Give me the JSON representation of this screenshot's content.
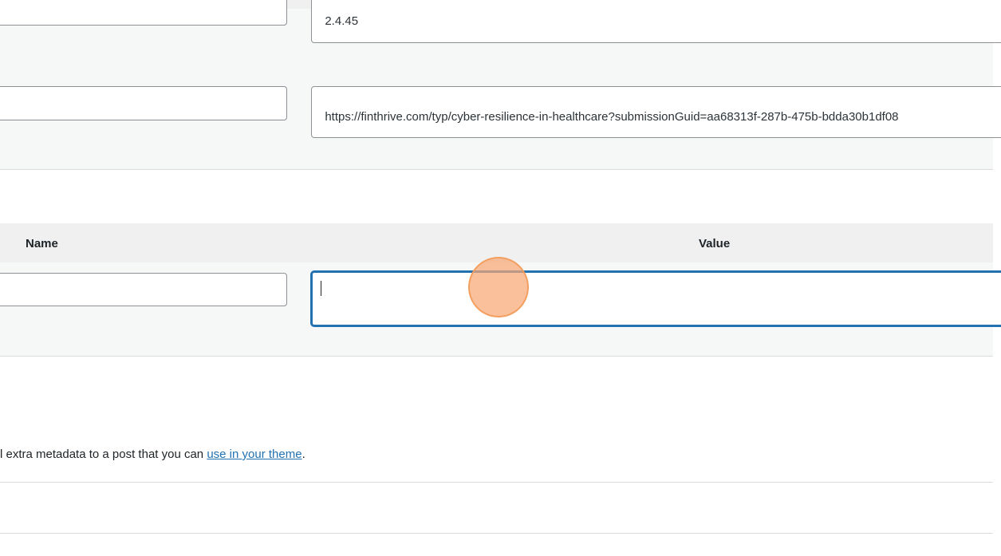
{
  "custom_fields": {
    "rows": [
      {
        "key_value": "",
        "meta_value": "2.4.45"
      },
      {
        "key_value": "",
        "meta_value": "https://finthrive.com/typ/cyber-resilience-in-healthcare?submissionGuid=aa68313f-287b-475b-bdda30b1df08"
      }
    ],
    "table_header": {
      "name": "Name",
      "value": "Value"
    },
    "new_row": {
      "key_value": "",
      "meta_value": ""
    },
    "description_prefix": "l extra metadata to a post that you can ",
    "description_link": "use in your theme",
    "description_suffix": "."
  },
  "colors": {
    "focus_border": "#2271b1",
    "link": "#2271b1",
    "click_indicator": "#f7a875"
  }
}
